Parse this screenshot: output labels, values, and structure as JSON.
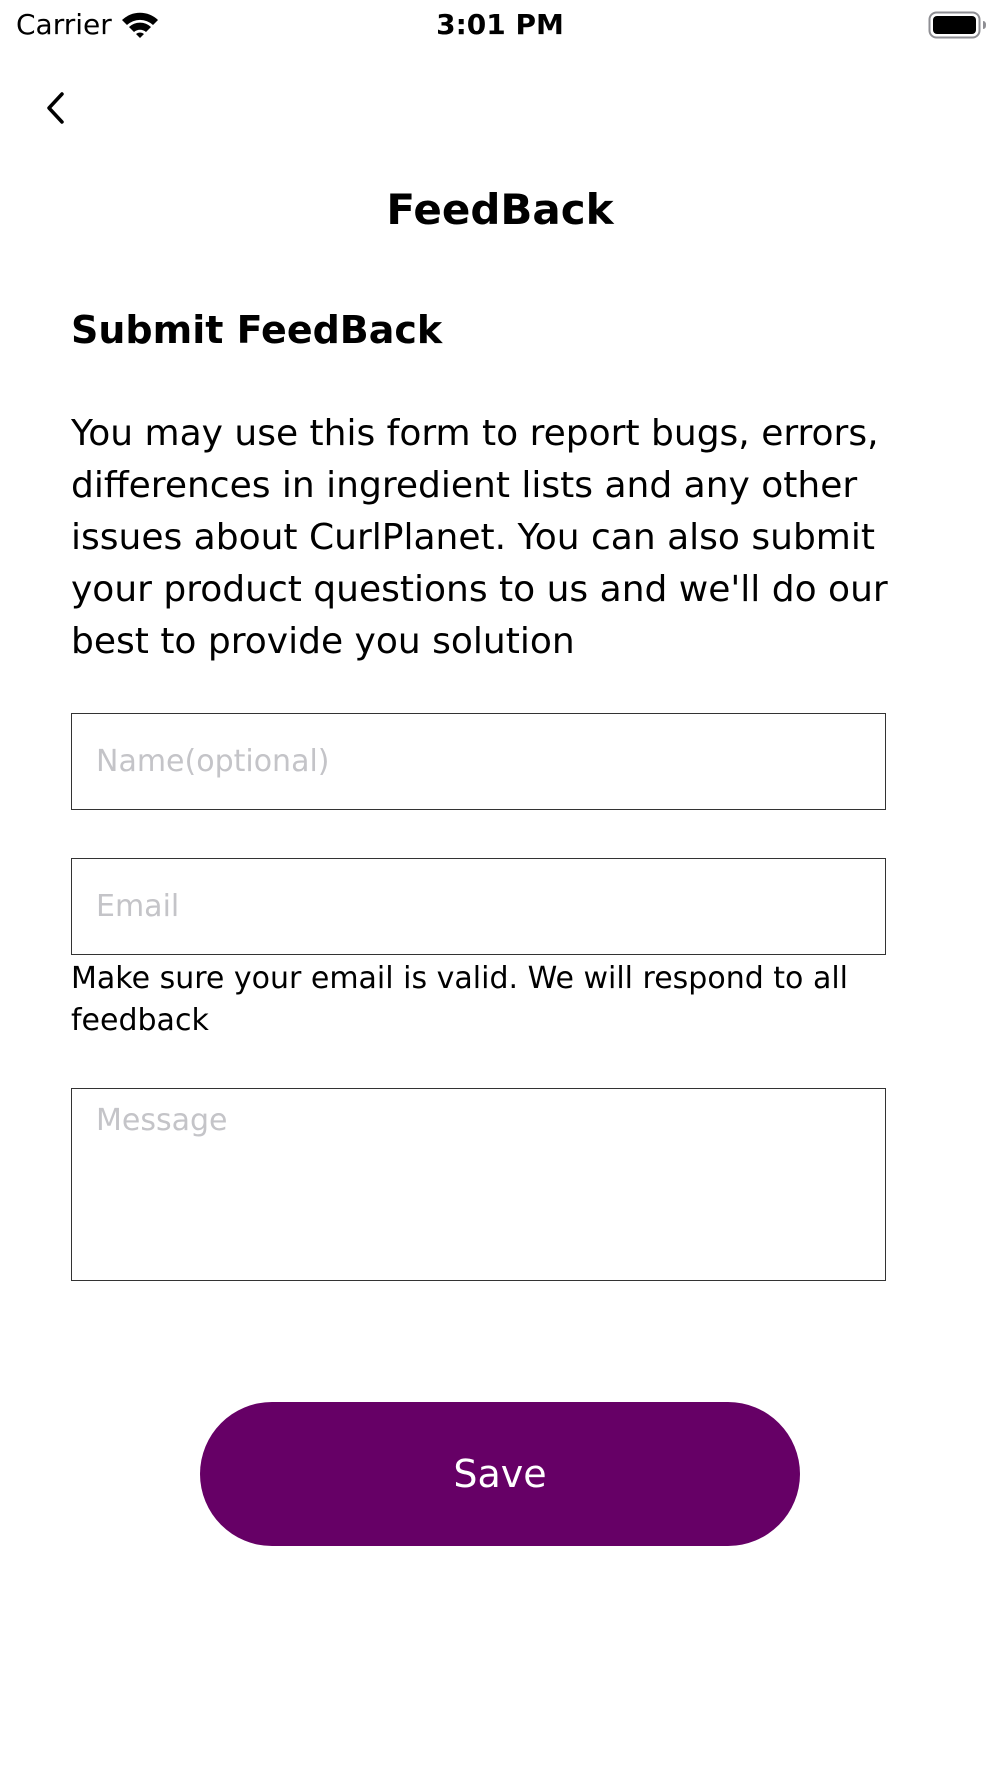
{
  "status_bar": {
    "carrier": "Carrier",
    "time": "3:01 PM",
    "wifi_icon": "wifi-icon",
    "battery_icon": "battery-full-icon"
  },
  "nav": {
    "back_icon": "chevron-left-icon",
    "title": "FeedBack"
  },
  "form": {
    "section_title": "Submit FeedBack",
    "description": "You may use this form to report bugs, errors, differences in ingredient lists and any other issues about CurlPlanet. You can also submit your product questions to us and we'll do our best to provide you solution",
    "name_placeholder": "Name(optional)",
    "email_placeholder": "Email",
    "email_hint": "Make sure your email is valid. We will respond to all feedback",
    "message_placeholder": "Message",
    "save_label": "Save"
  },
  "colors": {
    "accent": "#660066",
    "field_border": "#333333",
    "placeholder": "#c4c4c8"
  }
}
